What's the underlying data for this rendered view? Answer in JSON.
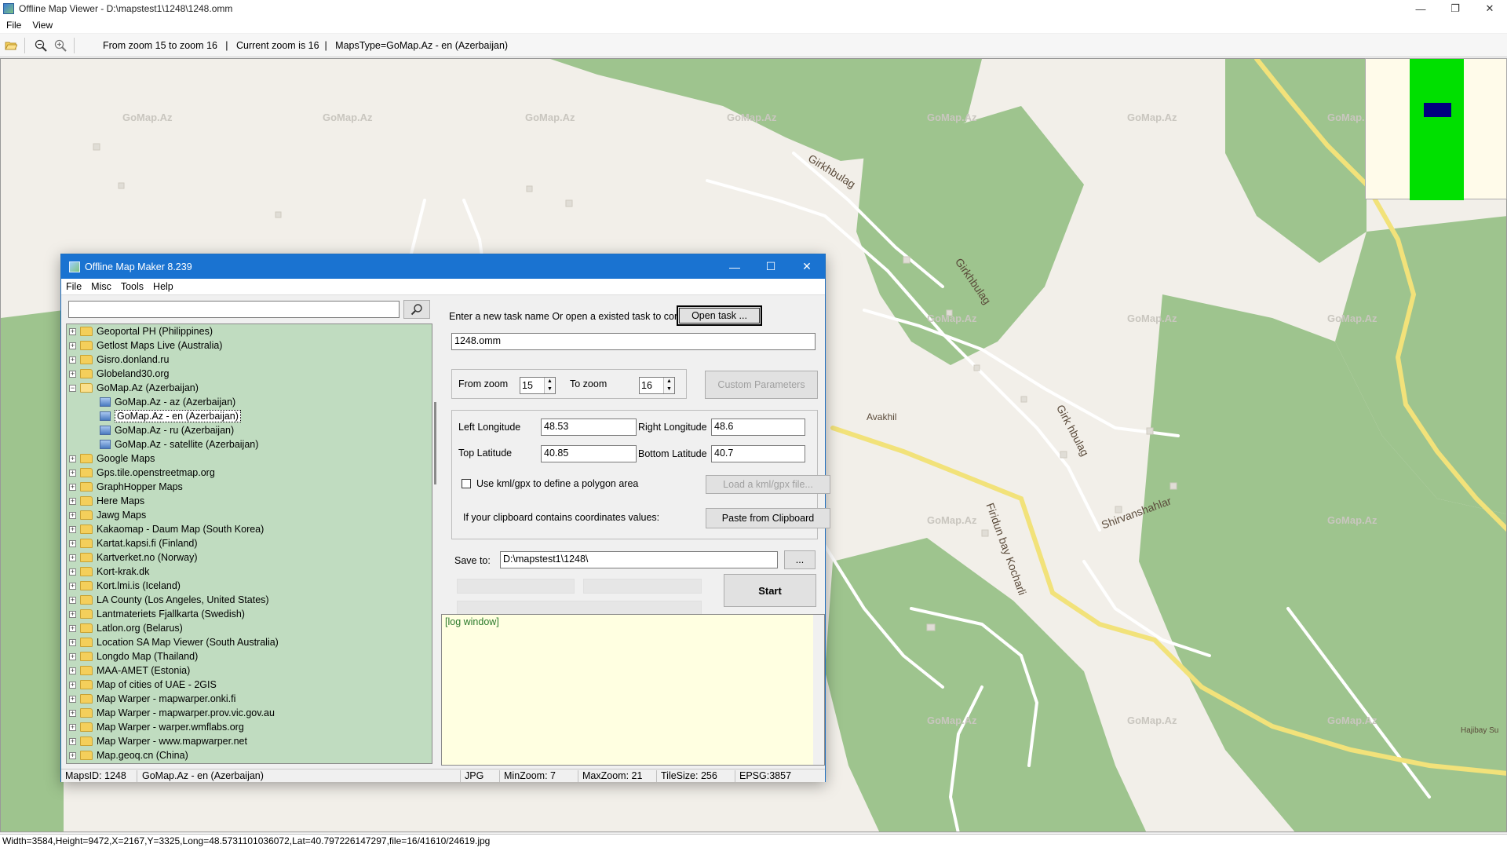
{
  "window": {
    "title": "Offline Map Viewer - D:\\mapstest1\\1248\\1248.omm",
    "controls": [
      "—",
      "❐",
      "✕"
    ]
  },
  "menu": [
    "File",
    "View"
  ],
  "toolbar": {
    "status": "From zoom 15 to zoom 16   |   Current zoom is 16  |   MapsType=GoMap.Az - en (Azerbaijan)"
  },
  "map": {
    "watermark": "GoMap.Az",
    "labels": [
      "Girkhbulag",
      "Girkhbulag",
      "Girk hbulag",
      "Avakhil",
      "Firidun bay Kocharli",
      "Shirvanshahlar",
      "Hajibay Su"
    ],
    "colors": {
      "land": "#f2efe9",
      "forest": "#9ec48e",
      "road_main": "#f2e27a",
      "road_minor": "#ffffff"
    }
  },
  "statusbar": {
    "text": "Width=3584,Height=9472,X=2167,Y=3325,Long=48.5731101036072,Lat=40.797226147297,file=16/41610/24619.jpg"
  },
  "dialog": {
    "title": "Offline Map Maker 8.239",
    "menu": [
      "File",
      "Misc",
      "Tools",
      "Help"
    ],
    "search": {
      "value": ""
    },
    "tree": [
      {
        "label": "Geoportal PH (Philippines)",
        "type": "folder"
      },
      {
        "label": "Getlost Maps Live (Australia)",
        "type": "folder"
      },
      {
        "label": "Gisro.donland.ru",
        "type": "folder"
      },
      {
        "label": "Globeland30.org",
        "type": "folder"
      },
      {
        "label": "GoMap.Az (Azerbaijan)",
        "type": "folder-open"
      },
      {
        "label": "GoMap.Az - az (Azerbaijan)",
        "type": "map"
      },
      {
        "label": "GoMap.Az - en (Azerbaijan)",
        "type": "map-selected"
      },
      {
        "label": "GoMap.Az - ru (Azerbaijan)",
        "type": "map"
      },
      {
        "label": "GoMap.Az - satellite (Azerbaijan)",
        "type": "map"
      },
      {
        "label": "Google Maps",
        "type": "folder"
      },
      {
        "label": "Gps.tile.openstreetmap.org",
        "type": "folder"
      },
      {
        "label": "GraphHopper Maps",
        "type": "folder"
      },
      {
        "label": "Here Maps",
        "type": "folder"
      },
      {
        "label": "Jawg Maps",
        "type": "folder"
      },
      {
        "label": "Kakaomap - Daum Map (South Korea)",
        "type": "folder"
      },
      {
        "label": "Kartat.kapsi.fi (Finland)",
        "type": "folder"
      },
      {
        "label": "Kartverket.no (Norway)",
        "type": "folder"
      },
      {
        "label": "Kort-krak.dk",
        "type": "folder"
      },
      {
        "label": "Kort.lmi.is (Iceland)",
        "type": "folder"
      },
      {
        "label": "LA County (Los Angeles, United States)",
        "type": "folder"
      },
      {
        "label": "Lantmateriets Fjallkarta (Swedish)",
        "type": "folder"
      },
      {
        "label": "Latlon.org (Belarus)",
        "type": "folder"
      },
      {
        "label": "Location SA Map Viewer (South Australia)",
        "type": "folder"
      },
      {
        "label": "Longdo Map (Thailand)",
        "type": "folder"
      },
      {
        "label": "MAA-AMET (Estonia)",
        "type": "folder"
      },
      {
        "label": "Map of cities of UAE - 2GIS",
        "type": "folder"
      },
      {
        "label": "Map Warper - mapwarper.onki.fi",
        "type": "folder"
      },
      {
        "label": "Map Warper - mapwarper.prov.vic.gov.au",
        "type": "folder"
      },
      {
        "label": "Map Warper - warper.wmflabs.org",
        "type": "folder"
      },
      {
        "label": "Map Warper - www.mapwarper.net",
        "type": "folder"
      },
      {
        "label": "Map.geoq.cn (China)",
        "type": "folder"
      }
    ],
    "form": {
      "task_prompt": "Enter a new task name Or open a existed task to continue:",
      "open_task_label": "Open task ...",
      "task_name": "1248.omm",
      "from_zoom_label": "From zoom",
      "from_zoom": "15",
      "to_zoom_label": "To zoom",
      "to_zoom": "16",
      "custom_params_label": "Custom Parameters",
      "left_lon_label": "Left Longitude",
      "left_lon": "48.53",
      "right_lon_label": "Right Longitude",
      "right_lon": "48.6",
      "top_lat_label": "Top Latitude",
      "top_lat": "40.85",
      "bottom_lat_label": "Bottom Latitude",
      "bottom_lat": "40.7",
      "kml_label": "Use kml/gpx to define a polygon area",
      "load_kml_label": "Load a kml/gpx file...",
      "clipboard_label": "If your clipboard contains coordinates values:",
      "paste_label": "Paste from Clipboard",
      "save_to_label": "Save to:",
      "save_to": "D:\\mapstest1\\1248\\",
      "browse_label": "...",
      "start_label": "Start"
    },
    "log": "[log window]",
    "status": {
      "maps_id": "MapsID: 1248",
      "map_name": "GoMap.Az - en (Azerbaijan)",
      "format": "JPG",
      "min_zoom": "MinZoom: 7",
      "max_zoom": "MaxZoom: 21",
      "tile_size": "TileSize: 256",
      "epsg": "EPSG:3857"
    }
  }
}
